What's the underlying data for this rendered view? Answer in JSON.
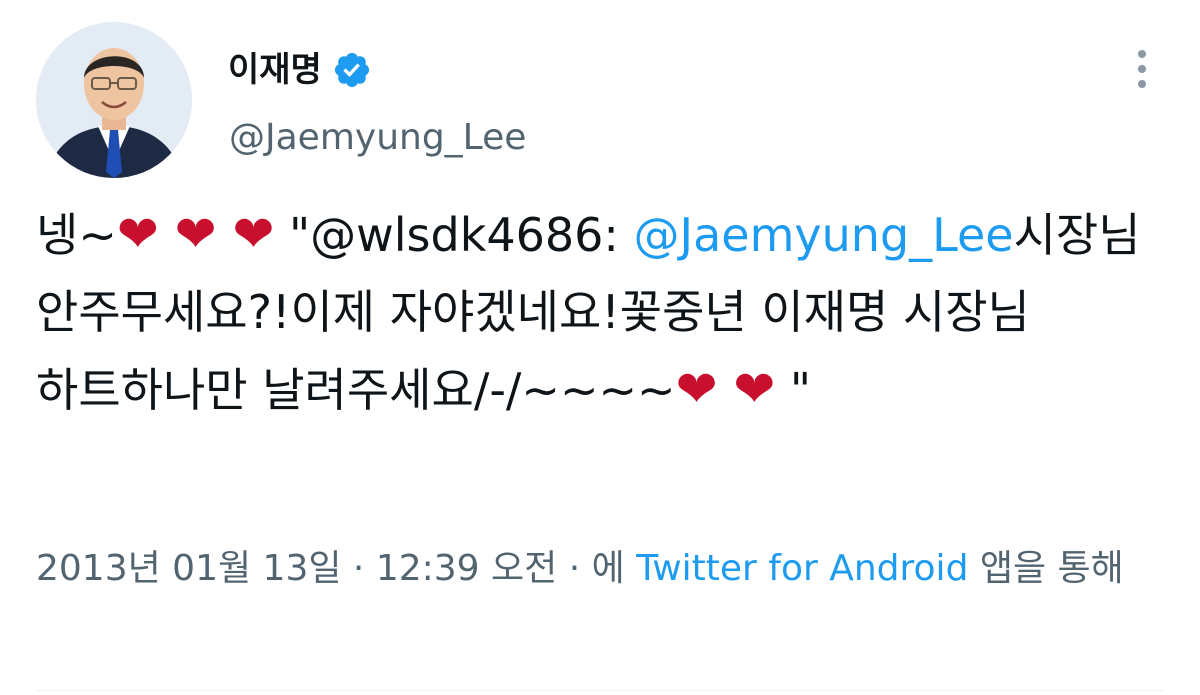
{
  "author": {
    "display_name": "이재명",
    "handle": "@Jaemyung_Lee",
    "verified": true
  },
  "tweet": {
    "text_part1": "넹~",
    "hearts_a": "❤ ❤ ❤",
    "text_part2": " \"@wlsdk4686: ",
    "mention": "@Jaemyung_Lee",
    "text_part3": "시장님 안주무세요?!이제 자야겠네요!꽃중년 이재명 시장님 하트하나만 날려주세요/-/~~~~",
    "hearts_b": "❤ ❤",
    "text_part4": " \""
  },
  "meta": {
    "date": "2013년 01월 13일",
    "separator1": " · ",
    "time": "12:39 오전",
    "separator2": " · ",
    "prefix": "에 ",
    "app_name": "Twitter for Android",
    "suffix": " 앱을 통해"
  },
  "colors": {
    "accent": "#1d9bf0",
    "heart": "#c8102e",
    "text": "#0f1419",
    "secondary": "#536471"
  }
}
